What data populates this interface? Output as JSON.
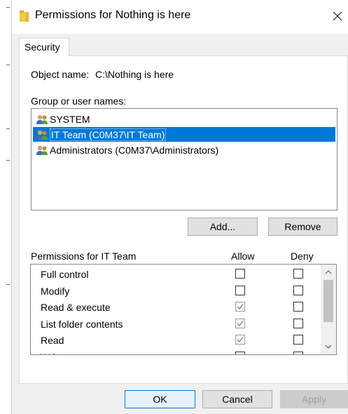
{
  "window": {
    "title": "Permissions for Nothing is here"
  },
  "tabs": [
    {
      "label": "Security"
    }
  ],
  "object": {
    "label": "Object name:",
    "value": "C:\\Nothing is here"
  },
  "groups": {
    "label": "Group or user names:",
    "items": [
      {
        "label": "SYSTEM",
        "selected": false
      },
      {
        "label": "IT Team (C0M37\\IT Team)",
        "selected": true
      },
      {
        "label": "Administrators (C0M37\\Administrators)",
        "selected": false
      }
    ]
  },
  "buttons": {
    "add": "Add...",
    "remove": "Remove",
    "ok": "OK",
    "cancel": "Cancel",
    "apply": "Apply"
  },
  "permissions": {
    "header": "Permissions for IT Team",
    "allow_header": "Allow",
    "deny_header": "Deny",
    "rows": [
      {
        "name": "Full control",
        "allow": false,
        "deny": false
      },
      {
        "name": "Modify",
        "allow": false,
        "deny": false
      },
      {
        "name": "Read & execute",
        "allow": true,
        "deny": false
      },
      {
        "name": "List folder contents",
        "allow": true,
        "deny": false
      },
      {
        "name": "Read",
        "allow": true,
        "deny": false
      },
      {
        "name": "Write",
        "allow": false,
        "deny": false
      }
    ]
  },
  "icons": {
    "folder": "folder-icon",
    "user": "user-group-icon",
    "close": "close-icon"
  },
  "colors": {
    "selection": "#0078d7",
    "folder": "#f2c84b"
  }
}
